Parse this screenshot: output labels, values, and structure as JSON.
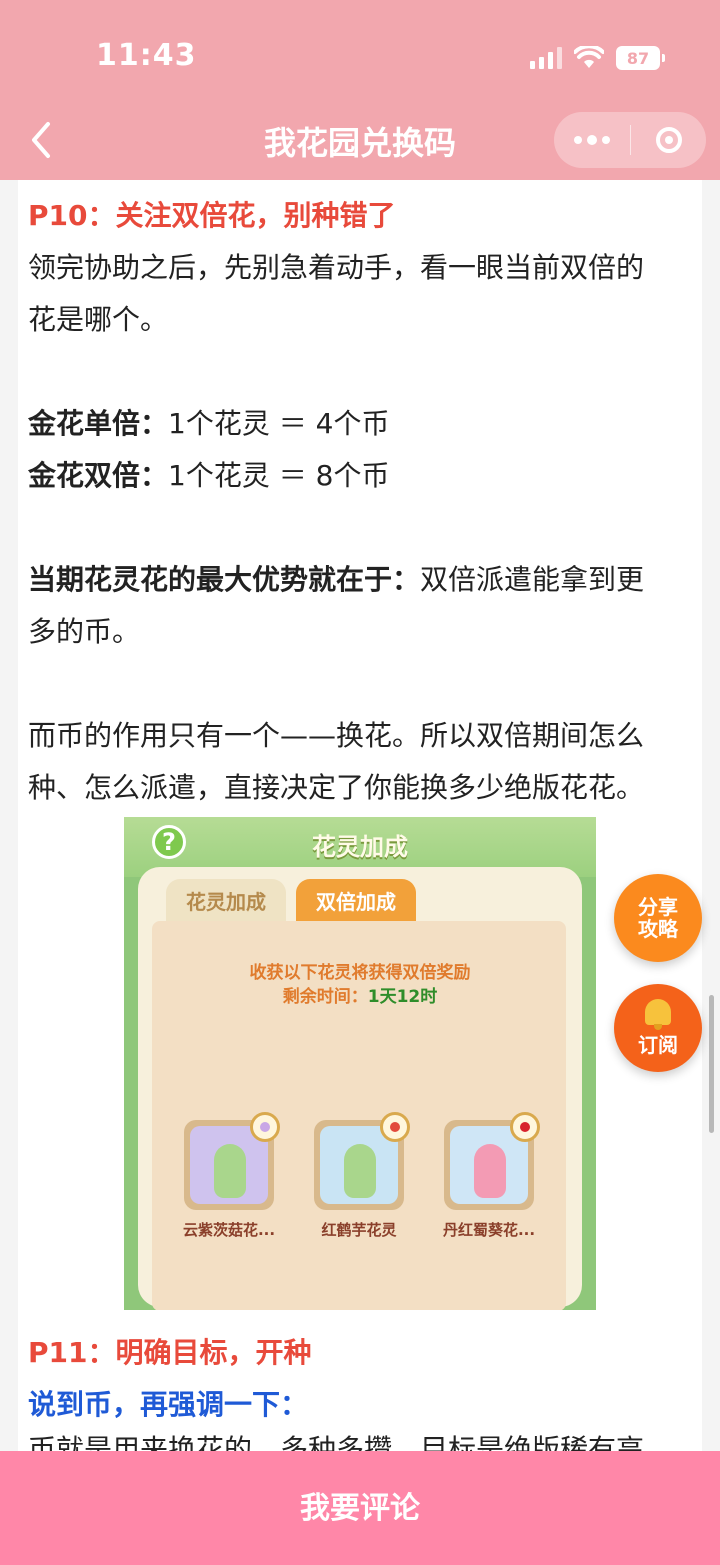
{
  "status_bar": {
    "time": "11:43",
    "battery": "87"
  },
  "nav": {
    "title": "我花园兑换码"
  },
  "article": {
    "p10_heading": "P10：关注双倍花，别种错了",
    "p10_line1": "领完协助之后，先别急着动手，看一眼当前双倍的",
    "p10_line2": "花是哪个。",
    "gold_single_label": "金花单倍：",
    "gold_single_value": "1个花灵 ＝ 4个币",
    "gold_double_label": "金花双倍：",
    "gold_double_value": "1个花灵 ＝ 8个币",
    "advantage_label": "当期花灵花的最大优势就在于：",
    "advantage_text1": "双倍派遣能拿到更",
    "advantage_text2": "多的币。",
    "coin_line1": "而币的作用只有一个——换花。所以双倍期间怎么",
    "coin_line2": "种、怎么派遣，直接决定了你能换多少绝版花花。",
    "p11_heading": "P11：明确目标，开种",
    "p11_sub": "说到币，再强调一下：",
    "cut_text": "币就是用来换花的，多种多攒，目标是绝版稀有高"
  },
  "game_screenshot": {
    "title": "花灵加成",
    "help": "?",
    "tab_inactive": "花灵加成",
    "tab_active": "双倍加成",
    "notice": "收获以下花灵将获得双倍奖励",
    "remaining_label": "剩余时间：",
    "remaining_value": "1天12时",
    "cards": [
      {
        "name": "云紫茨菇花...",
        "badge_color": "#c9a7e6",
        "bg": "#cfc3ee",
        "figure": "#a9d68c"
      },
      {
        "name": "红鹤芋花灵",
        "badge_color": "#e24a3c",
        "bg": "#c9e4f4",
        "figure": "#a9d68c"
      },
      {
        "name": "丹红蜀葵花...",
        "badge_color": "#d8222b",
        "bg": "#cfe6f6",
        "figure": "#f39bb4"
      }
    ]
  },
  "floating": {
    "share_line1": "分享",
    "share_line2": "攻略",
    "subscribe": "订阅"
  },
  "bottom": {
    "comment": "我要评论"
  },
  "colors": {
    "header": "#f2a7ae",
    "bottom_bar": "#ff87a8",
    "heading_red": "#e84a3b",
    "heading_blue": "#1f5ad6"
  }
}
